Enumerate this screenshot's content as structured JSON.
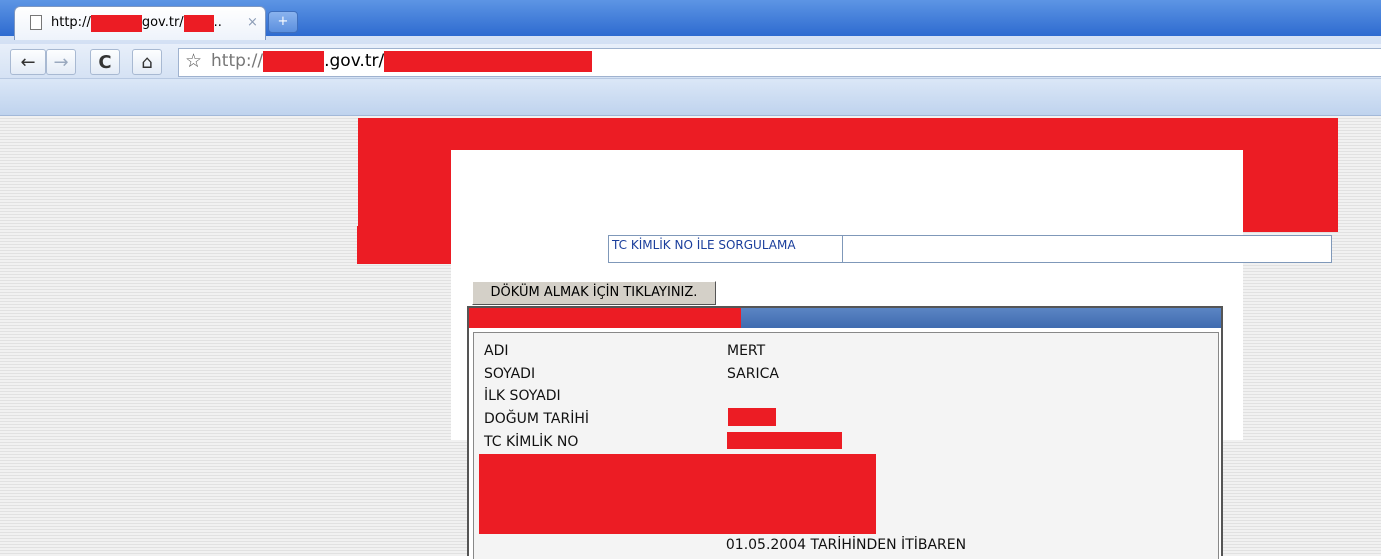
{
  "browser": {
    "tab": {
      "title_prefix": "http://",
      "title_mid": "gov.tr/",
      "title_suffix": "..",
      "close_glyph": "×"
    },
    "new_tab_glyph": "+",
    "address_bar": {
      "url_prefix": "http://",
      "url_mid": ".gov.tr/"
    },
    "icons": [
      "back-arrow-icon",
      "forward-arrow-icon",
      "reload-icon",
      "home-icon",
      "star-icon",
      "page-icon"
    ]
  },
  "page": {
    "query_tab_label": "TC KİMLİK NO İLE SORGULAMA",
    "print_button_label": "DÖKÜM ALMAK İÇİN TIKLAYINIZ.",
    "person": {
      "fields": [
        {
          "label": "ADI",
          "value": "MERT"
        },
        {
          "label": "SOYADI",
          "value": "SARICA"
        },
        {
          "label": "İLK SOYADI",
          "value": ""
        },
        {
          "label": "DOĞUM TARİHİ",
          "value": ""
        },
        {
          "label": "TC KİMLİK NO",
          "value": ""
        }
      ],
      "footer_note": "01.05.2004 TARİHİNDEN İTİBAREN"
    }
  },
  "colors": {
    "redaction": "#ec1c24",
    "table_header": "#3f6bb0",
    "link_text": "#1a3e9c"
  }
}
